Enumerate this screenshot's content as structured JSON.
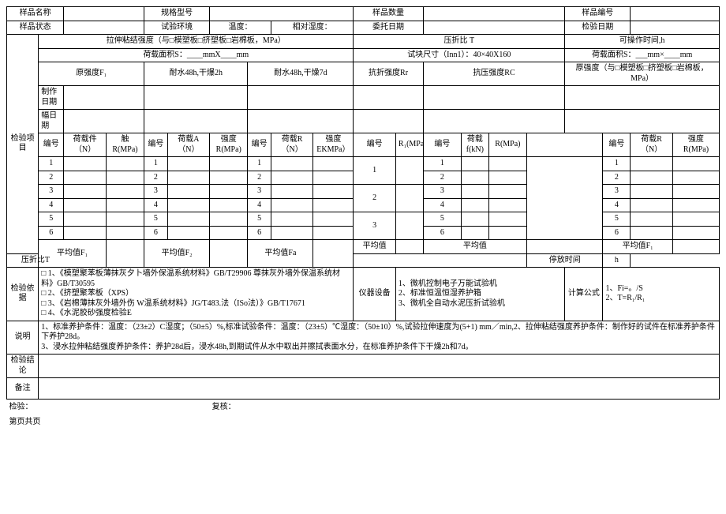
{
  "top": {
    "sample_name_l": "样品名称",
    "spec_model_l": "规格型号",
    "sample_qty_l": "样品数量",
    "sample_no_l": "样品编号",
    "sample_state_l": "样品状态",
    "test_env_l": "试验环境",
    "temp_l": "温度：",
    "rh_l": "相对湿度：",
    "entrust_date_l": "委托日期",
    "test_date_l": "检验日期"
  },
  "headers": {
    "tensile": "拉伸粘结强度（与□模塑板□挤塑板□岩棉板，MPa）",
    "flex_ratio": "压折比 T",
    "workable": "可操作时间,h",
    "load_area_s": "荷载面积S：____mmX____mm",
    "specimen": "试块尺寸（Inn1）：40×40X160",
    "load_area_s2": "荷载面积S：___mm×____mm",
    "orig_f1": "原强度F₁",
    "water_48_2": "耐水48h,干爆2h",
    "water_48_7": "耐水48h,干燥7d",
    "flex_rr": "抗折强度Rr",
    "comp_rc": "抗压强度RC",
    "orig_strength_right": "原强度（与□模塑板□挤塑板□岩棉板，MPa）",
    "make_date": "制作日期",
    "row_date": "幅日期",
    "no": "编号",
    "load_n": "荷载件（N）",
    "r_mpa_infl": "触R(MPa)",
    "load_a_n": "荷载A（N）",
    "strength_rmpa": "强度R(MPa)",
    "load_r_n": "荷载R（N）",
    "strength_ekmpa": "强度EKMPa）",
    "r1_mpa": "R₁(MPa)",
    "load_kn": "荷载f(kN)",
    "r_mpa": "R(MPa)",
    "strength_rmpa2": "强度R(MPa)"
  },
  "section_labels": {
    "test_items": "检验项目",
    "test_basis": "检验依据",
    "instructions": "说明",
    "conclusion": "检验结论",
    "remarks": "备注"
  },
  "avg": {
    "f1": "平均值F₁",
    "f2": "平均值F₂",
    "fa": "平均值Fa",
    "plain": "平均值",
    "fr": "平均值F₁",
    "flex_bottom": "压折比T",
    "pause": "停放时间",
    "pause_unit": "h"
  },
  "nums": [
    "1",
    "2",
    "3",
    "4",
    "5",
    "6"
  ],
  "nums3": [
    "1",
    "2",
    "3"
  ],
  "basis": {
    "left": "□ 1、《模塑聚苯板薄抹灰夕卜墙外保温系统材料》GB/T29906 尊抹灰外墙外保温系统材料》GB/T30595\n□ 2、《挤塑聚苯板（XPS）\n□ 3、《岩棉薄抹灰外墙外伤 W温系统材料》JG/T483.法（ISo法）》GB/T17671\n□ 4、《水泥胶砂强度检验E",
    "equip_l": "仪器设备",
    "equip": "1、微机控制电子万能试验机\n2、标准恒温恒湿养护箱\n3、微机全自动水泥压折试验机",
    "calc_l": "计算公式",
    "calc": "1、Fi=。/S\n2、T=R₁/R₁"
  },
  "explain": "1、标准养护条件：温度：（23±2）C湿度；（50±5）%,标准试验条件：温度：（23±5）℃湿度：（50±10）%,试验拉伸速度为(5+1) mm／min,2、拉伸粘结强度养护条件：制作好的试件在标准养护条件下养护28d。\n3、浸水拉伸粘结强度养护条件：养护28d后，浸水48h,到期试件从水中取出并擦拭表面水分，在标准养护条件下干燥2h和7d。",
  "footer": {
    "inspect": "检验：",
    "review": "复核：",
    "page": "第页共页"
  }
}
